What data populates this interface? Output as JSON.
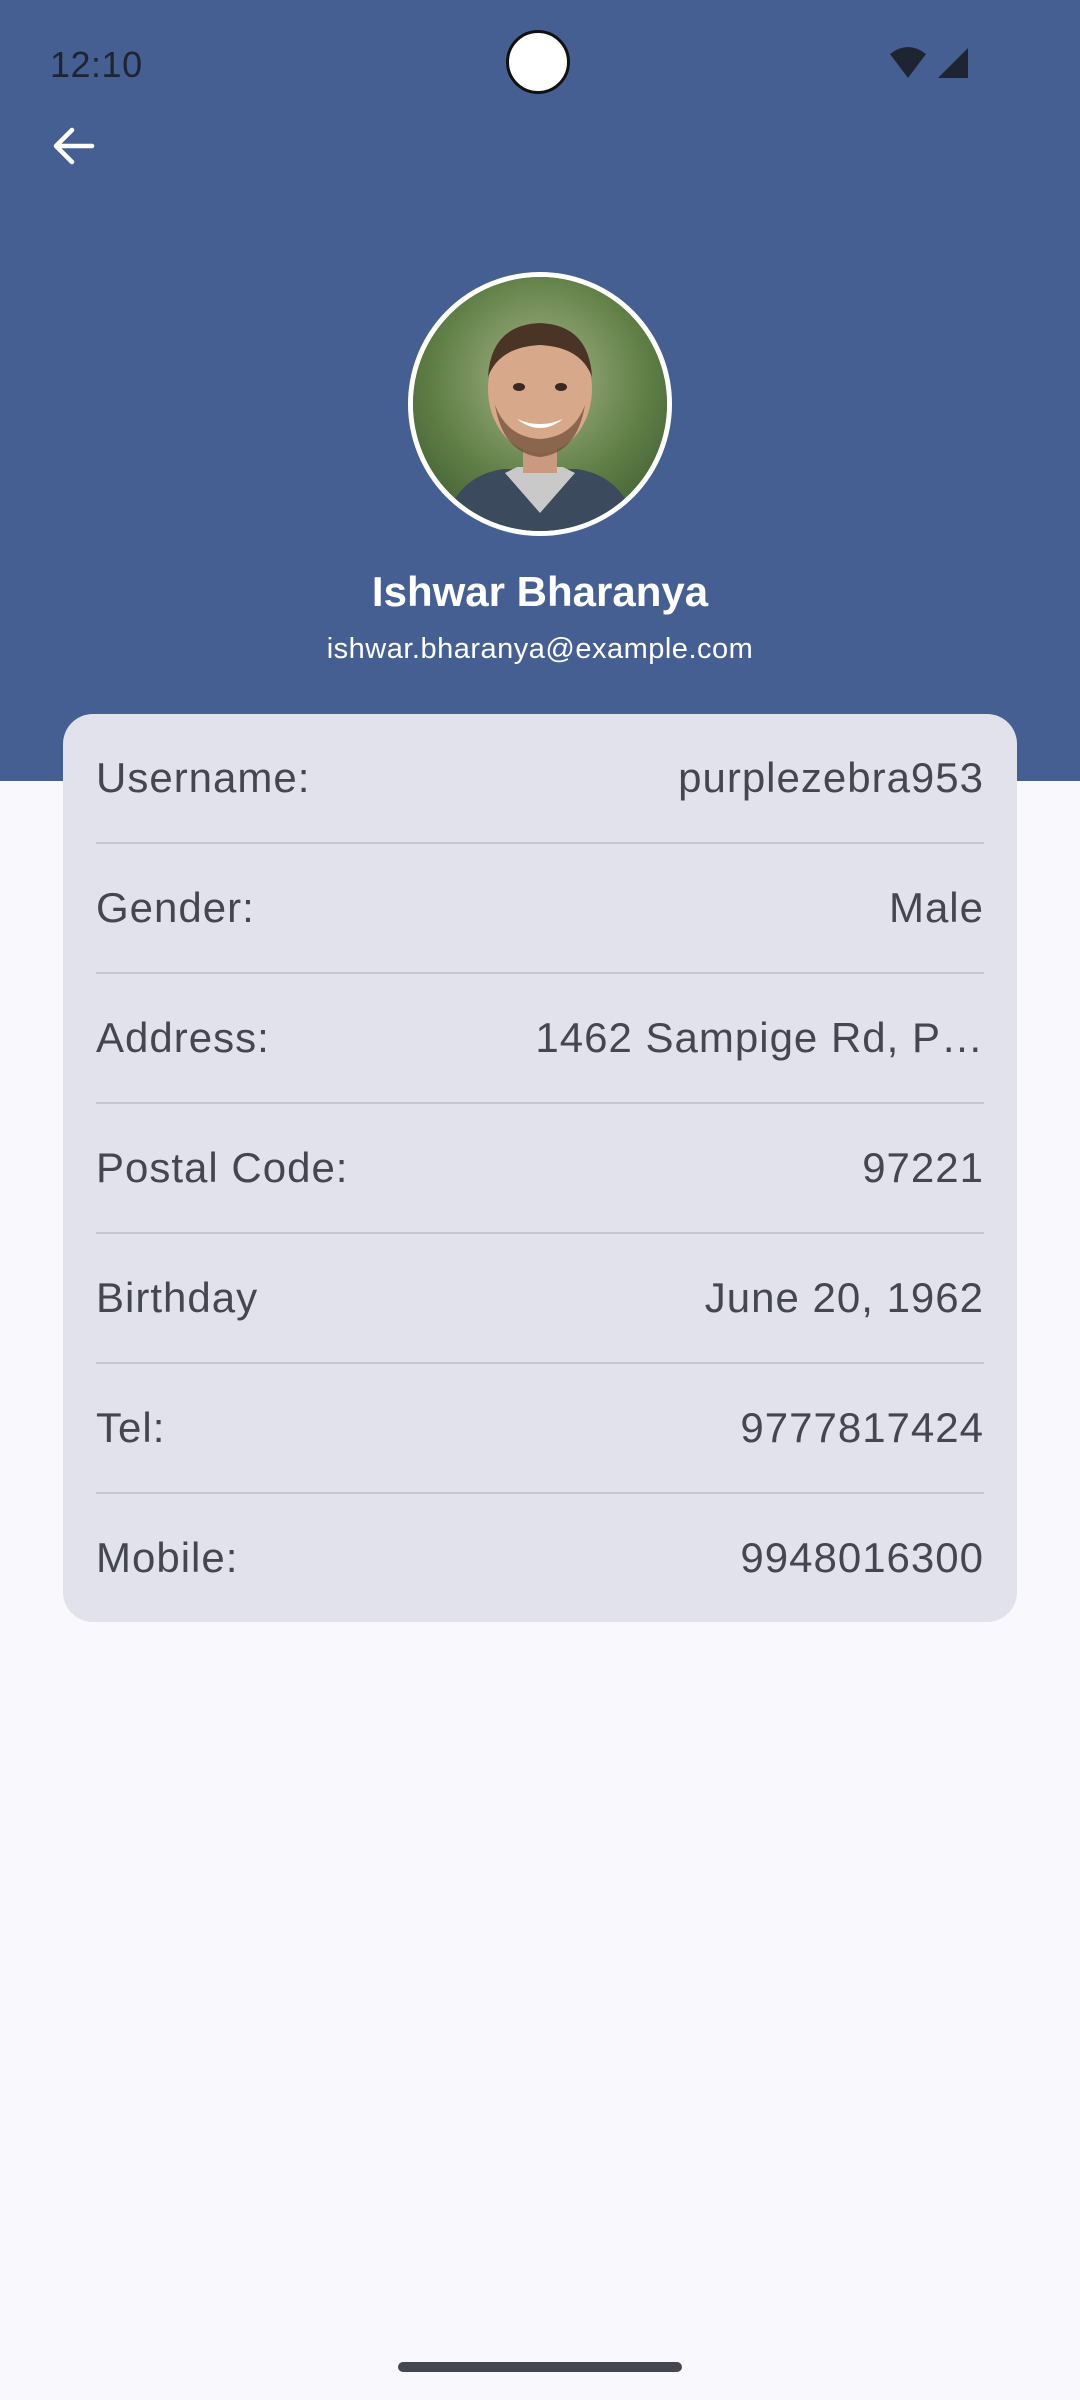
{
  "status_bar": {
    "time": "12:10",
    "icons": [
      "wifi-icon",
      "signal-icon"
    ]
  },
  "nav": {
    "back_icon": "arrow-left-icon"
  },
  "profile": {
    "name": "Ishwar Bharanya",
    "email": "ishwar.bharanya@example.com"
  },
  "details": [
    {
      "label": "Username:",
      "value": "purplezebra953"
    },
    {
      "label": "Gender:",
      "value": "Male"
    },
    {
      "label": "Address:",
      "value": "1462 Sampige Rd, P…"
    },
    {
      "label": "Postal Code:",
      "value": "97221"
    },
    {
      "label": "Birthday",
      "value": "June 20, 1962"
    },
    {
      "label": "Tel:",
      "value": "9777817424"
    },
    {
      "label": "Mobile:",
      "value": "9948016300"
    }
  ],
  "colors": {
    "header": "#465f93",
    "background": "#f8f8fd",
    "card": "#e2e2ec",
    "text": "#44474f",
    "divider": "#c4c6d0"
  }
}
